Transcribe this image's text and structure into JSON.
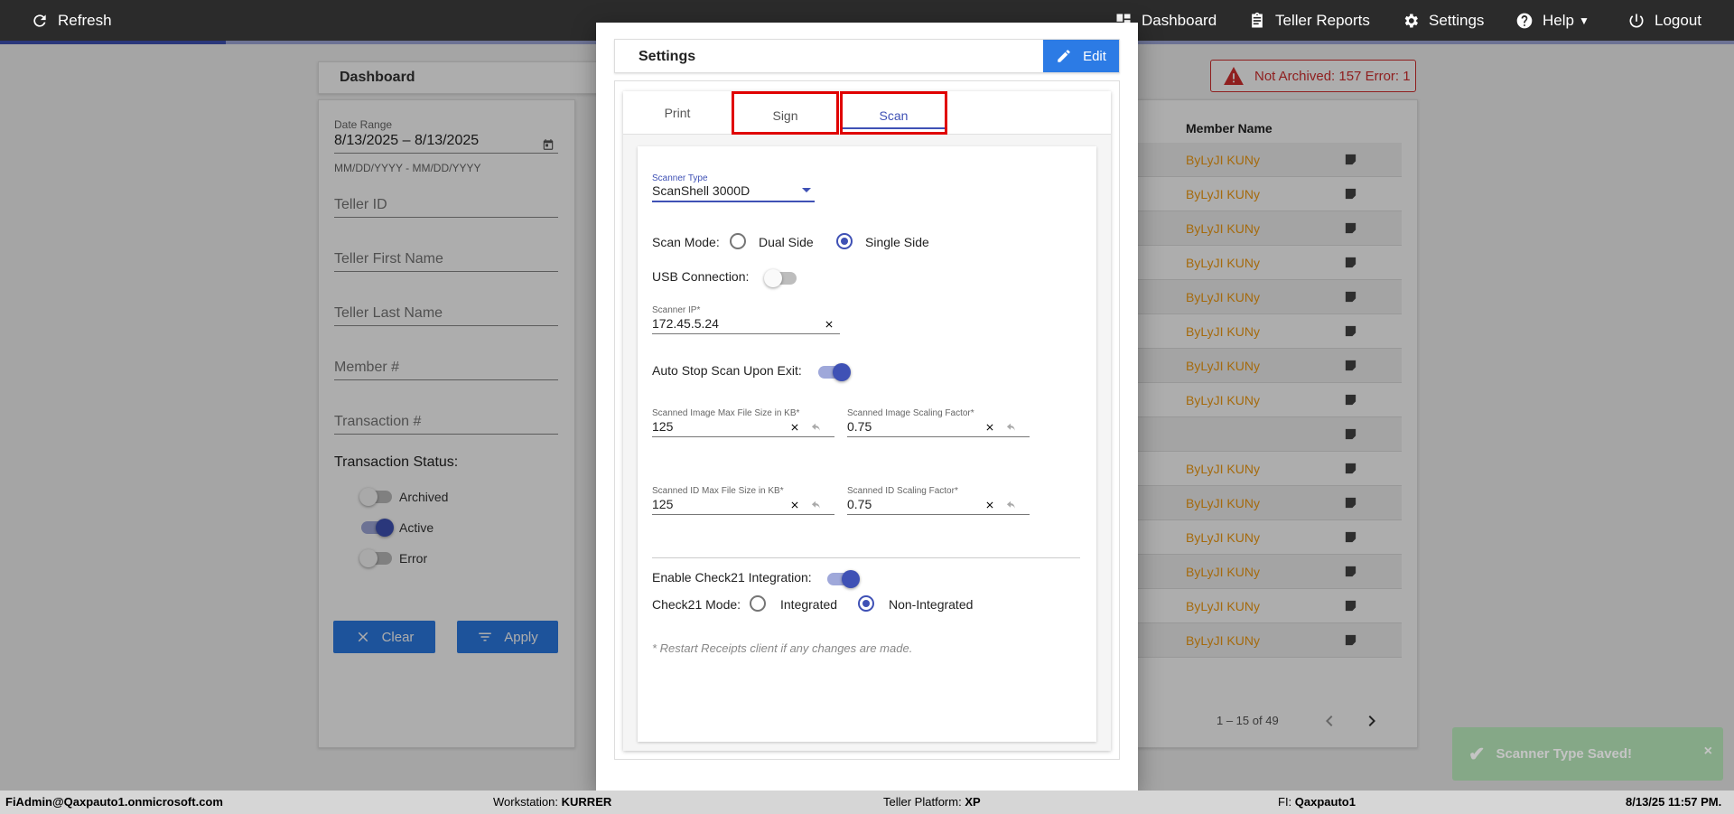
{
  "topbar": {
    "refresh": "Refresh",
    "dashboard": "Dashboard",
    "teller_reports": "Teller Reports",
    "settings": "Settings",
    "help": "Help",
    "logout": "Logout"
  },
  "dashboard": {
    "title": "Dashboard",
    "date_range_label": "Date Range",
    "date_range_value": "8/13/2025 – 8/13/2025",
    "date_hint": "MM/DD/YYYY - MM/DD/YYYY",
    "teller_id": "Teller ID",
    "teller_first": "Teller First Name",
    "teller_last": "Teller Last Name",
    "member": "Member #",
    "transaction": "Transaction #",
    "status_title": "Transaction Status:",
    "status_archived": "Archived",
    "status_active": "Active",
    "status_error": "Error",
    "clear": "Clear",
    "apply": "Apply"
  },
  "alert": {
    "text": "Not Archived: 157  Error: 1"
  },
  "table": {
    "col_member": "Member Name",
    "rows": [
      "ByLyJI KUNy",
      "ByLyJI KUNy",
      "ByLyJI KUNy",
      "ByLyJI KUNy",
      "ByLyJI KUNy",
      "ByLyJI KUNy",
      "ByLyJI KUNy",
      "ByLyJI KUNy",
      "",
      "ByLyJI KUNy",
      "ByLyJI KUNy",
      "ByLyJI KUNy",
      "ByLyJI KUNy",
      "ByLyJI KUNy",
      "ByLyJI KUNy"
    ],
    "pager": "1 – 15 of 49"
  },
  "modal": {
    "title": "Settings",
    "edit": "Edit",
    "tabs": [
      "Print",
      "Sign",
      "Scan"
    ],
    "scanner_type_label": "Scanner Type",
    "scanner_type_value": "ScanShell 3000D",
    "scan_mode_label": "Scan Mode:",
    "scan_mode_dual": "Dual Side",
    "scan_mode_single": "Single Side",
    "usb_label": "USB Connection:",
    "scanner_ip_label": "Scanner IP*",
    "scanner_ip_value": "172.45.5.24",
    "auto_stop_label": "Auto Stop Scan Upon Exit:",
    "img_max_label": "Scanned Image Max File Size in KB*",
    "img_max_value": "125",
    "img_scale_label": "Scanned Image Scaling Factor*",
    "img_scale_value": "0.75",
    "id_max_label": "Scanned ID Max File Size in KB*",
    "id_max_value": "125",
    "id_scale_label": "Scanned ID Scaling Factor*",
    "id_scale_value": "0.75",
    "check21_label": "Enable Check21 Integration:",
    "check21_mode_label": "Check21 Mode:",
    "check21_integrated": "Integrated",
    "check21_non": "Non-Integrated",
    "note": "* Restart Receipts client if any changes are made."
  },
  "toast": {
    "text": "Scanner Type Saved!",
    "close": "×"
  },
  "statusbar": {
    "user": "FiAdmin@Qaxpauto1.onmicrosoft.com",
    "workstation_label": "Workstation:",
    "workstation": "KURRER",
    "platform_label": "Teller Platform:",
    "platform": "XP",
    "fi_label": "FI:",
    "fi": "Qaxpauto1",
    "datetime": "8/13/25 11:57 PM."
  },
  "colors": {
    "accent": "#3f51b5",
    "button": "#2c7be5",
    "error": "#d32f2f",
    "member_name": "#f39c12",
    "highlight": "#e00000"
  },
  "icons": {
    "refresh": "refresh-icon",
    "dashboard": "dashboard-icon",
    "reports": "clipboard-icon",
    "settings": "gear-icon",
    "help": "help-icon",
    "logout": "power-icon"
  }
}
